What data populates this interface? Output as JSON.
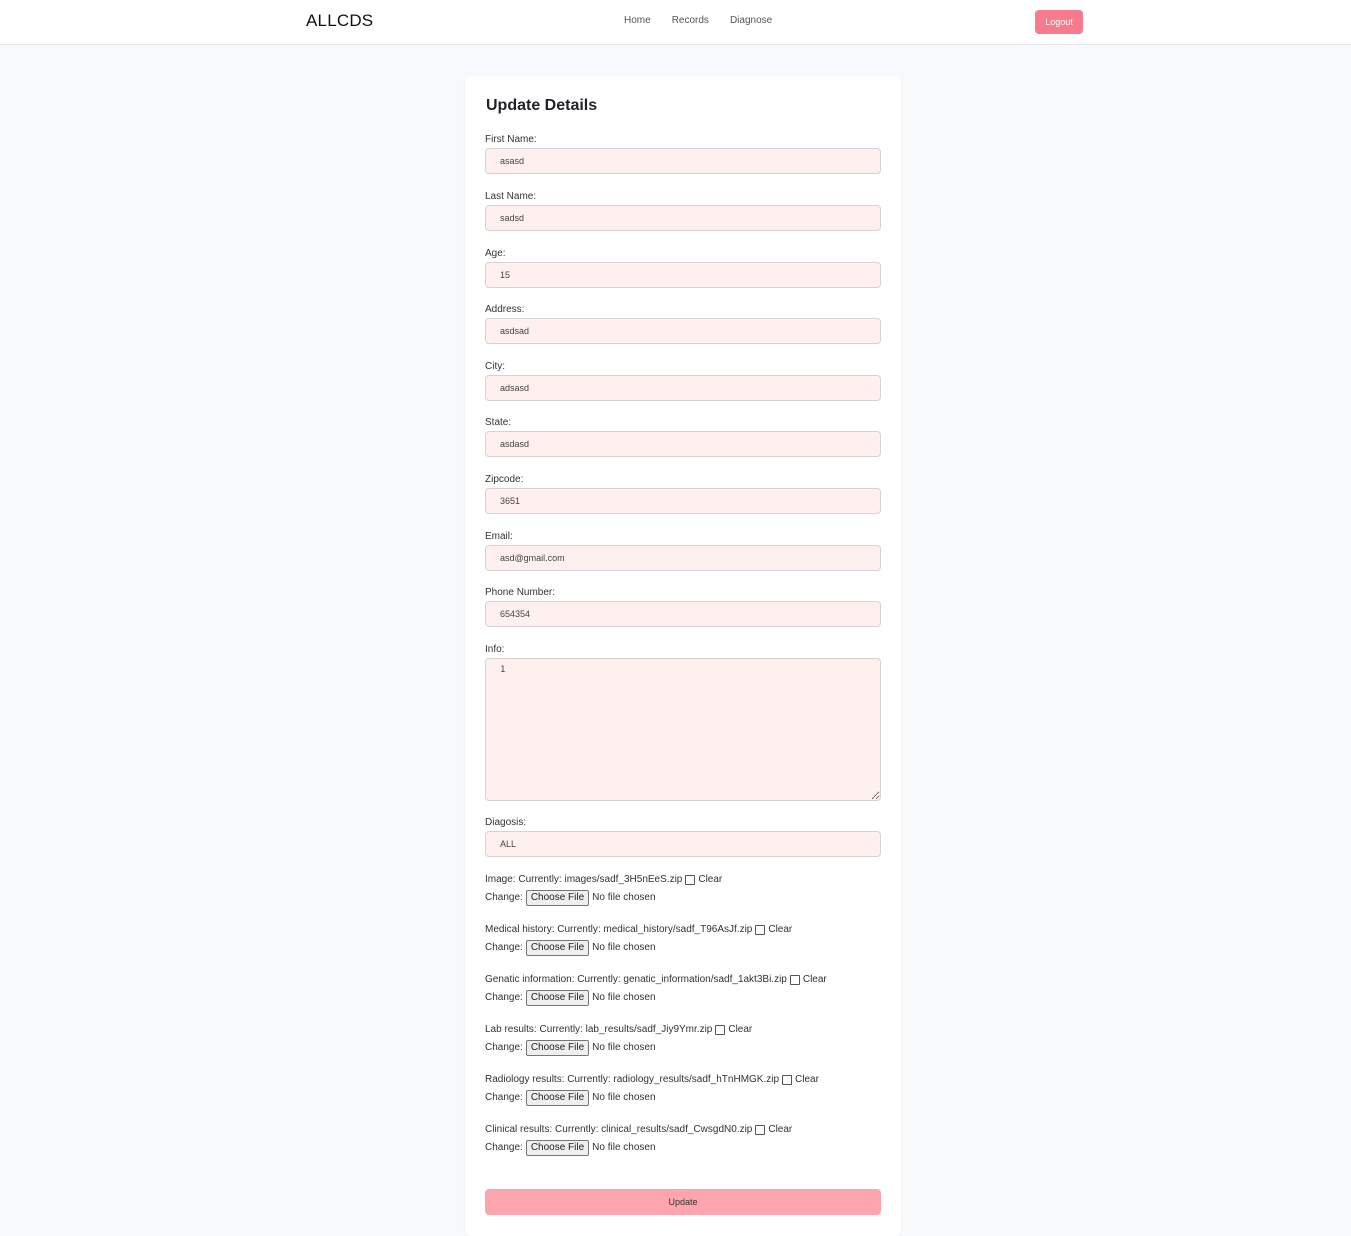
{
  "navbar": {
    "brand": "ALLCDS",
    "links": [
      "Home",
      "Records",
      "Diagnose"
    ],
    "logout_label": "Logout"
  },
  "form": {
    "title": "Update Details",
    "fields": [
      {
        "label": "First Name:",
        "value": "asasd"
      },
      {
        "label": "Last Name:",
        "value": "sadsd"
      },
      {
        "label": "Age:",
        "value": "15"
      },
      {
        "label": "Address:",
        "value": "asdsad"
      },
      {
        "label": "City:",
        "value": "adsasd"
      },
      {
        "label": "State:",
        "value": "asdasd"
      },
      {
        "label": "Zipcode:",
        "value": "3651"
      },
      {
        "label": "Email:",
        "value": "asd@gmail.com"
      },
      {
        "label": "Phone Number:",
        "value": "654354"
      }
    ],
    "info": {
      "label": "Info:",
      "value": "1"
    },
    "diagnosis": {
      "label": "Diagosis:",
      "value": "ALL"
    },
    "files": [
      {
        "label": "Image:",
        "current": "images/sadf_3H5nEeS.zip"
      },
      {
        "label": "Medical history:",
        "current": "medical_history/sadf_T96AsJf.zip"
      },
      {
        "label": "Genatic information:",
        "current": "genatic_information/sadf_1akt3Bi.zip"
      },
      {
        "label": "Lab results:",
        "current": "lab_results/sadf_Jiy9Ymr.zip"
      },
      {
        "label": "Radiology results:",
        "current": "radiology_results/sadf_hTnHMGK.zip"
      },
      {
        "label": "Clinical results:",
        "current": "clinical_results/sadf_CwsgdN0.zip"
      }
    ],
    "file_texts": {
      "currently": "Currently:",
      "clear": "Clear",
      "change": "Change:",
      "choose": "Choose File",
      "no_file": "No file chosen"
    },
    "submit_label": "Update"
  },
  "colors": {
    "accent": "#f77b8d",
    "input_bg": "#fff0f0",
    "submit_bg": "#fda4af",
    "page_bg": "#f8f9fa"
  }
}
